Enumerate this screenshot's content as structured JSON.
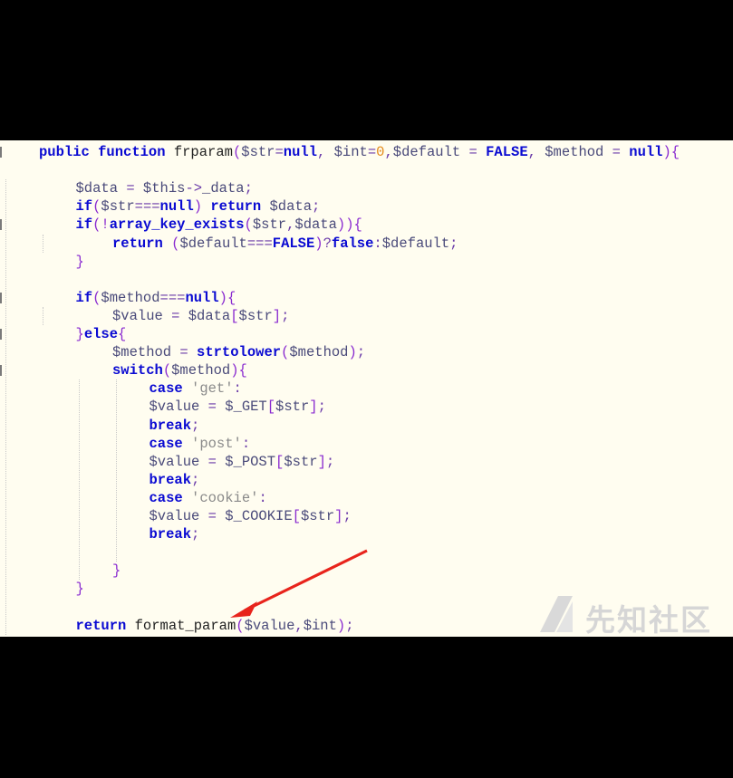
{
  "code_lines": [
    [
      [
        "kw",
        "public function "
      ],
      [
        "fn",
        "frparam"
      ],
      [
        "pn",
        "("
      ],
      [
        "var",
        "$str"
      ],
      [
        "op",
        "="
      ],
      [
        "kw",
        "null"
      ],
      [
        "op",
        ", "
      ],
      [
        "var",
        "$int"
      ],
      [
        "op",
        "="
      ],
      [
        "num",
        "0"
      ],
      [
        "op",
        ","
      ],
      [
        "var",
        "$default"
      ],
      [
        "op",
        " = "
      ],
      [
        "kw",
        "FALSE"
      ],
      [
        "op",
        ", "
      ],
      [
        "var",
        "$method"
      ],
      [
        "op",
        " = "
      ],
      [
        "kw",
        "null"
      ],
      [
        "pn",
        "){"
      ]
    ],
    [],
    [
      [
        "var",
        "$data"
      ],
      [
        "op",
        " = "
      ],
      [
        "var",
        "$this"
      ],
      [
        "op",
        "->"
      ],
      [
        "var",
        "_data"
      ],
      [
        "op",
        ";"
      ]
    ],
    [
      [
        "kw",
        "if"
      ],
      [
        "pn",
        "("
      ],
      [
        "var",
        "$str"
      ],
      [
        "op",
        "==="
      ],
      [
        "kw",
        "null"
      ],
      [
        "pn",
        ") "
      ],
      [
        "kw",
        "return "
      ],
      [
        "var",
        "$data"
      ],
      [
        "op",
        ";"
      ]
    ],
    [
      [
        "kw",
        "if"
      ],
      [
        "pn",
        "(!"
      ],
      [
        "kw",
        "array_key_exists"
      ],
      [
        "pn",
        "("
      ],
      [
        "var",
        "$str"
      ],
      [
        "op",
        ","
      ],
      [
        "var",
        "$data"
      ],
      [
        "pn",
        "))"
      ],
      [
        "pn",
        "{"
      ]
    ],
    [
      [
        "kw",
        "return "
      ],
      [
        "pn",
        "("
      ],
      [
        "var",
        "$default"
      ],
      [
        "op",
        "==="
      ],
      [
        "kw",
        "FALSE"
      ],
      [
        "pn",
        ")"
      ],
      [
        "op",
        "?"
      ],
      [
        "kw",
        "false"
      ],
      [
        "op",
        ":"
      ],
      [
        "var",
        "$default"
      ],
      [
        "op",
        ";"
      ]
    ],
    [
      [
        "pn",
        "}"
      ]
    ],
    [],
    [
      [
        "kw",
        "if"
      ],
      [
        "pn",
        "("
      ],
      [
        "var",
        "$method"
      ],
      [
        "op",
        "==="
      ],
      [
        "kw",
        "null"
      ],
      [
        "pn",
        "){"
      ]
    ],
    [
      [
        "var",
        "$value"
      ],
      [
        "op",
        " = "
      ],
      [
        "var",
        "$data"
      ],
      [
        "pn",
        "["
      ],
      [
        "var",
        "$str"
      ],
      [
        "pn",
        "]"
      ],
      [
        "op",
        ";"
      ]
    ],
    [
      [
        "pn",
        "}"
      ],
      [
        "kw",
        "else"
      ],
      [
        "pn",
        "{"
      ]
    ],
    [
      [
        "var",
        "$method"
      ],
      [
        "op",
        " = "
      ],
      [
        "kw",
        "strtolower"
      ],
      [
        "pn",
        "("
      ],
      [
        "var",
        "$method"
      ],
      [
        "pn",
        ")"
      ],
      [
        "op",
        ";"
      ]
    ],
    [
      [
        "kw",
        "switch"
      ],
      [
        "pn",
        "("
      ],
      [
        "var",
        "$method"
      ],
      [
        "pn",
        "){"
      ]
    ],
    [
      [
        "kw",
        "case "
      ],
      [
        "str",
        "'get'"
      ],
      [
        "op",
        ":"
      ]
    ],
    [
      [
        "var",
        "$value"
      ],
      [
        "op",
        " = "
      ],
      [
        "var",
        "$_GET"
      ],
      [
        "pn",
        "["
      ],
      [
        "var",
        "$str"
      ],
      [
        "pn",
        "]"
      ],
      [
        "op",
        ";"
      ]
    ],
    [
      [
        "kw",
        "break"
      ],
      [
        "op",
        ";"
      ]
    ],
    [
      [
        "kw",
        "case "
      ],
      [
        "str",
        "'post'"
      ],
      [
        "op",
        ":"
      ]
    ],
    [
      [
        "var",
        "$value"
      ],
      [
        "op",
        " = "
      ],
      [
        "var",
        "$_POST"
      ],
      [
        "pn",
        "["
      ],
      [
        "var",
        "$str"
      ],
      [
        "pn",
        "]"
      ],
      [
        "op",
        ";"
      ]
    ],
    [
      [
        "kw",
        "break"
      ],
      [
        "op",
        ";"
      ]
    ],
    [
      [
        "kw",
        "case "
      ],
      [
        "str",
        "'cookie'"
      ],
      [
        "op",
        ":"
      ]
    ],
    [
      [
        "var",
        "$value"
      ],
      [
        "op",
        " = "
      ],
      [
        "var",
        "$_COOKIE"
      ],
      [
        "pn",
        "["
      ],
      [
        "var",
        "$str"
      ],
      [
        "pn",
        "]"
      ],
      [
        "op",
        ";"
      ]
    ],
    [
      [
        "kw",
        "break"
      ],
      [
        "op",
        ";"
      ]
    ],
    [],
    [
      [
        "pn",
        "}"
      ]
    ],
    [
      [
        "pn",
        "}"
      ]
    ],
    [],
    [
      [
        "kw",
        "return "
      ],
      [
        "fn",
        "format_param"
      ],
      [
        "pn",
        "("
      ],
      [
        "var",
        "$value"
      ],
      [
        "op",
        ","
      ],
      [
        "var",
        "$int"
      ],
      [
        "pn",
        ")"
      ],
      [
        "op",
        ";"
      ]
    ]
  ],
  "indent_levels": [
    1,
    0,
    2,
    2,
    2,
    3,
    2,
    0,
    2,
    3,
    2,
    3,
    3,
    4,
    4,
    4,
    4,
    4,
    4,
    4,
    4,
    4,
    0,
    3,
    2,
    0,
    2
  ],
  "watermark": {
    "text": "先知社区",
    "icon": "xianzhi-logo-icon"
  },
  "annotation": {
    "icon": "red-arrow-icon",
    "color": "#e8241c"
  },
  "colors": {
    "editor_bg": "#fffdf0",
    "keyword": "#0a0ad2",
    "number": "#e48a18",
    "string": "#8a8a8a"
  }
}
